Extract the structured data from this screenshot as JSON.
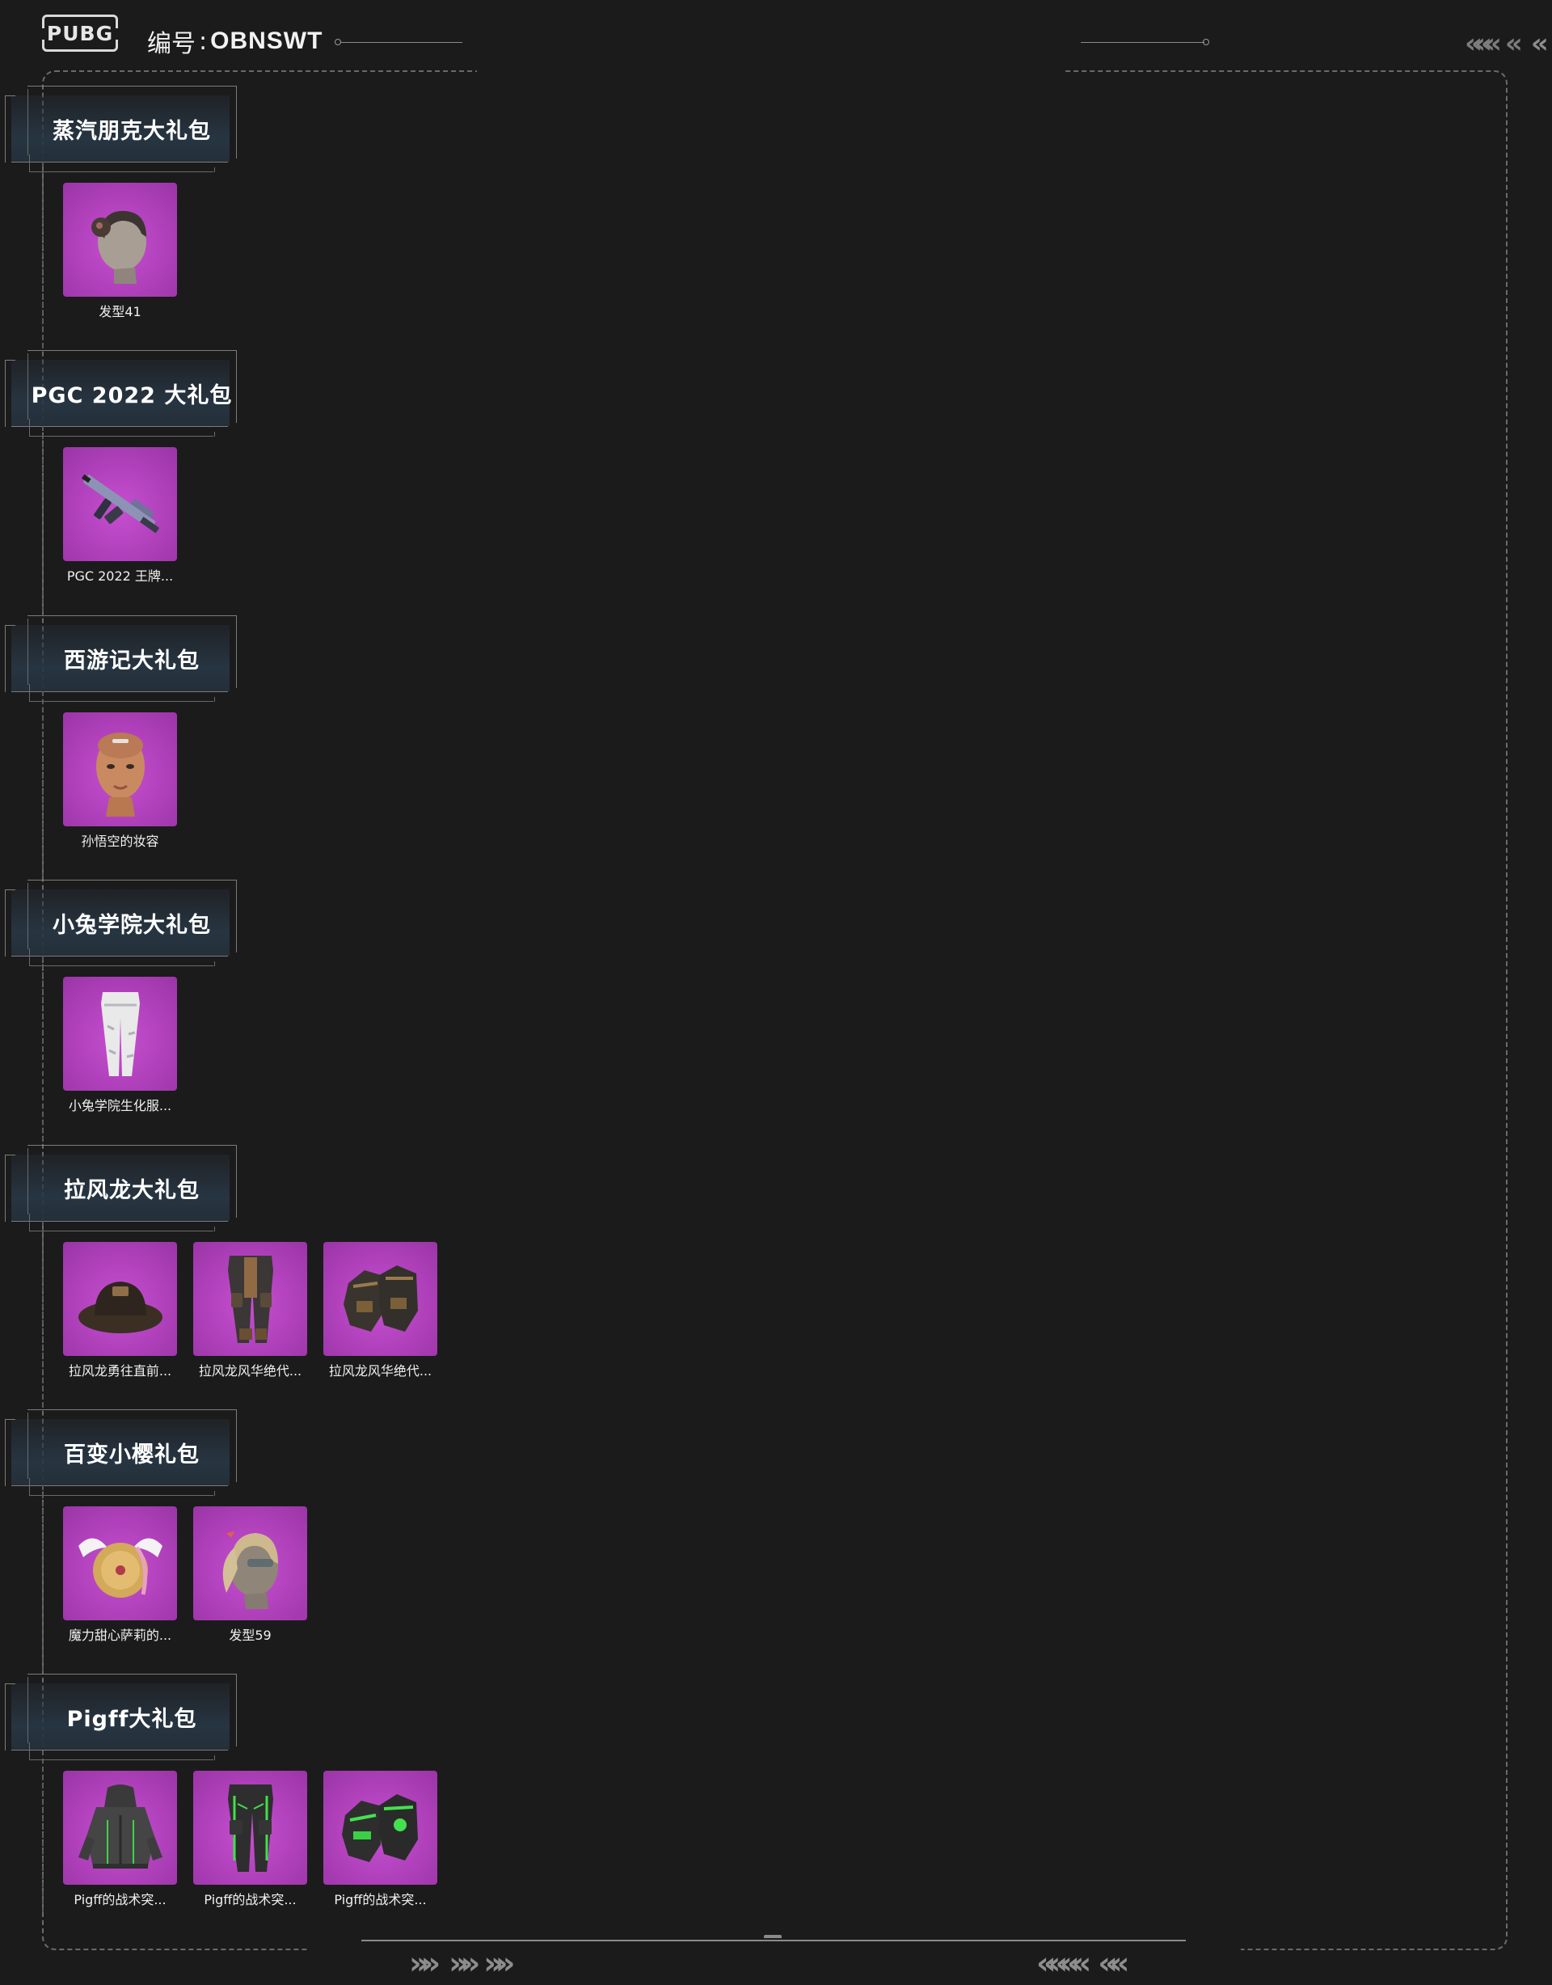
{
  "header": {
    "logo": "PUBG",
    "serial_label": "编号",
    "serial_sep": ":",
    "serial_code": "OBNSWT"
  },
  "sections": [
    {
      "title": "蒸汽朋克大礼包",
      "items": [
        {
          "name": "发型41",
          "icon": "hairstyle-bun-icon"
        }
      ]
    },
    {
      "title": "PGC 2022 大礼包",
      "items": [
        {
          "name": "PGC 2022 王牌...",
          "icon": "rifle-icon"
        }
      ]
    },
    {
      "title": "西游记大礼包",
      "items": [
        {
          "name": "孙悟空的妆容",
          "icon": "face-makeup-icon"
        }
      ]
    },
    {
      "title": "小兔学院大礼包",
      "items": [
        {
          "name": "小兔学院生化服...",
          "icon": "white-pants-icon"
        }
      ]
    },
    {
      "title": "拉风龙大礼包",
      "items": [
        {
          "name": "拉风龙勇往直前...",
          "icon": "bucket-hat-icon"
        },
        {
          "name": "拉风龙风华绝代...",
          "icon": "cargo-pants-icon"
        },
        {
          "name": "拉风龙风华绝代...",
          "icon": "gloves-icon"
        }
      ]
    },
    {
      "title": "百变小樱礼包",
      "items": [
        {
          "name": "魔力甜心萨莉的...",
          "icon": "winged-backpack-icon"
        },
        {
          "name": "发型59",
          "icon": "hairstyle-ponytail-icon"
        }
      ]
    },
    {
      "title": "Pigff大礼包",
      "items": [
        {
          "name": "Pigff的战术突...",
          "icon": "hooded-jacket-icon"
        },
        {
          "name": "Pigff的战术突...",
          "icon": "tactical-pants-icon"
        },
        {
          "name": "Pigff的战术突...",
          "icon": "tactical-gloves-icon"
        }
      ]
    }
  ],
  "colors": {
    "background": "#1b1b1c",
    "thumb": "#b043bc",
    "title_box": "#2a3844",
    "line": "#7c7c7c"
  }
}
